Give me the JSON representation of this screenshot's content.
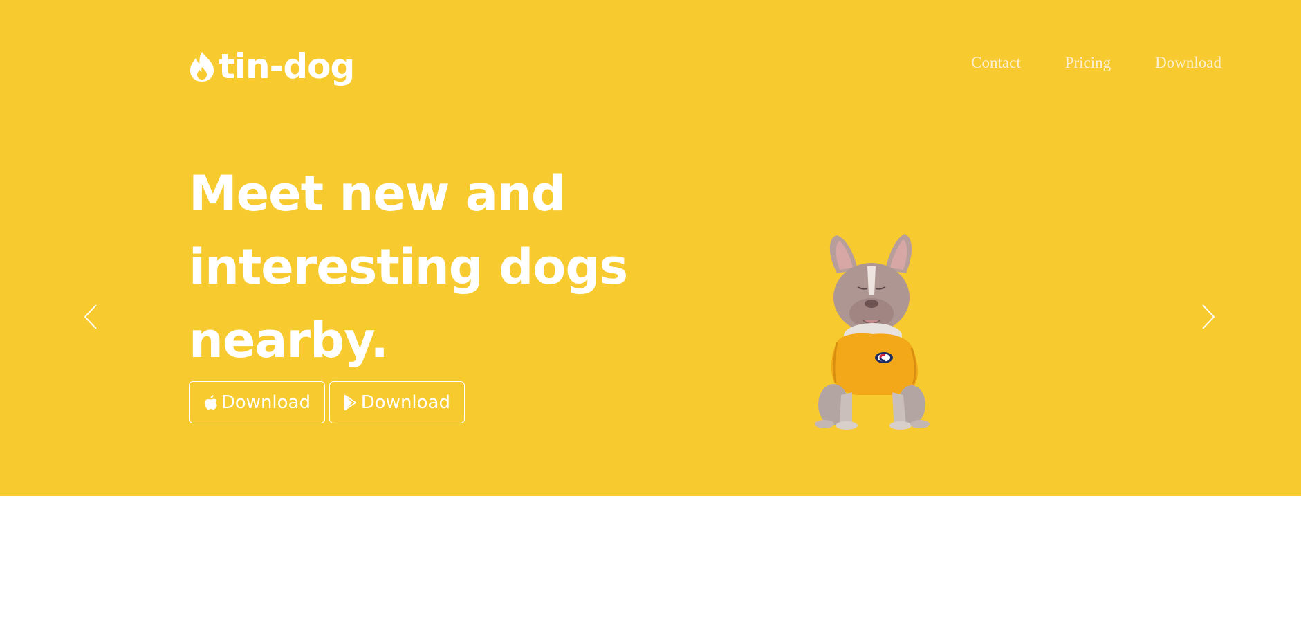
{
  "brand": {
    "name": "tin-dog",
    "logo_icon": "flame-icon"
  },
  "nav": {
    "items": [
      {
        "label": "Contact"
      },
      {
        "label": "Pricing"
      },
      {
        "label": "Download"
      }
    ]
  },
  "hero": {
    "headline": "Meet new and interesting dogs nearby.",
    "buttons": [
      {
        "icon": "apple-icon",
        "label": "Download"
      },
      {
        "icon": "google-play-icon",
        "label": "Download"
      }
    ],
    "image": "french-bulldog-in-yellow-sweater",
    "carousel": {
      "prev_icon": "chevron-left-icon",
      "next_icon": "chevron-right-icon"
    }
  },
  "colors": {
    "hero_background": "#F7CB2F",
    "text": "#FFFFFF",
    "nav_text": "#FBEFD0",
    "page_background": "#FFFFFF"
  }
}
